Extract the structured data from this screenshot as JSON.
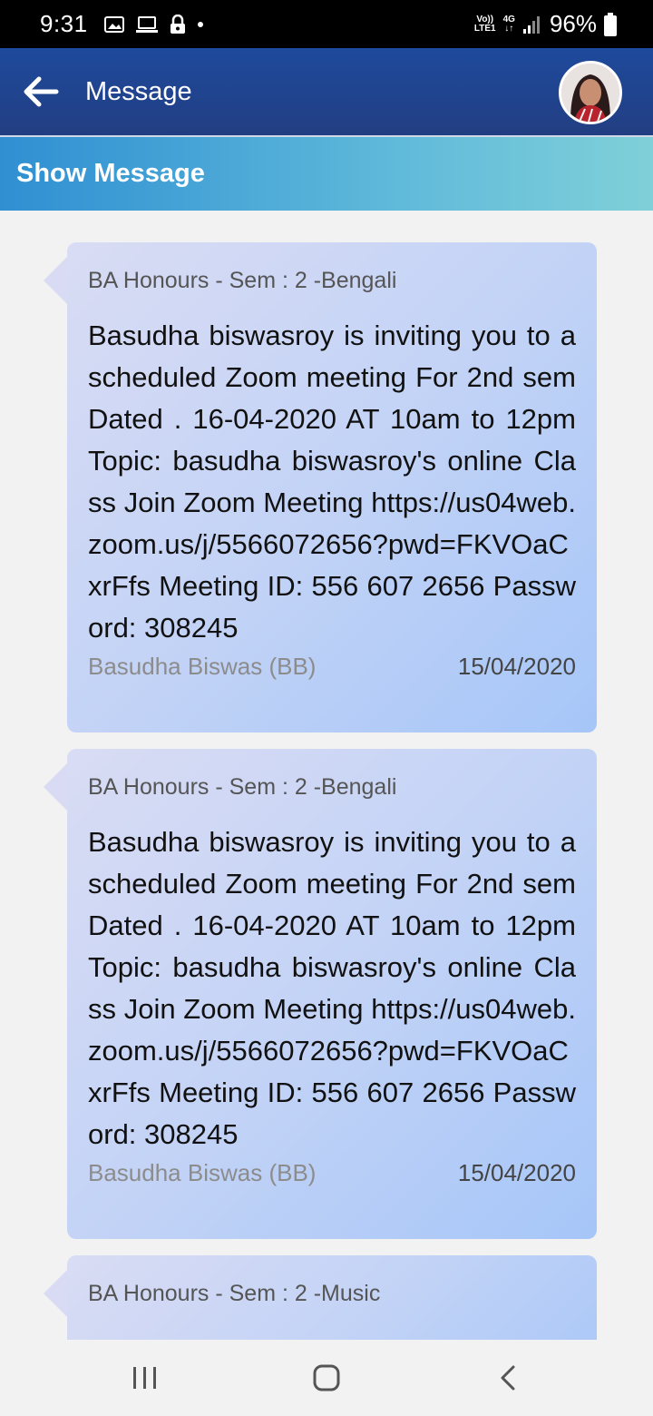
{
  "status_bar": {
    "time": "9:31",
    "network_top": "Vo))",
    "network_bottom": "LTE1",
    "network_type": "4G",
    "battery": "96%"
  },
  "header": {
    "title": "Message"
  },
  "sub_header": {
    "title": "Show Message"
  },
  "messages": [
    {
      "course": "BA Honours - Sem : 2 -Bengali",
      "body": "Basudha biswasroy is inviting you to a scheduled Zoom meeting For 2nd sem Dated . 16-04-2020  AT 10am to 12pm   Topic: basudha biswasroy's online Class Join Zoom Meeting https://us04web.zoom.us/j/5566072656?pwd=FKVOaCxrFfs Meeting ID: 556 607 2656 Password: 308245",
      "sender": "Basudha Biswas (BB)",
      "date": "15/04/2020"
    },
    {
      "course": "BA Honours - Sem : 2 -Bengali",
      "body": "Basudha biswasroy is inviting you to a scheduled Zoom meeting For 2nd sem Dated . 16-04-2020  AT 10am to 12pm   Topic: basudha biswasroy's online Class Join Zoom Meeting https://us04web.zoom.us/j/5566072656?pwd=FKVOaCxrFfs Meeting ID: 556 607 2656 Password: 308245",
      "sender": "Basudha Biswas (BB)",
      "date": "15/04/2020"
    },
    {
      "course": "BA Honours - Sem : 2 -Music"
    }
  ],
  "icons": {
    "back": "arrow-left-icon",
    "nav_recents": "recents-icon",
    "nav_home": "home-icon",
    "nav_back": "chevron-left-icon"
  },
  "colors": {
    "header": "#223e82",
    "sub_header_start": "#2f8fd2",
    "sub_header_end": "#7fd0d8",
    "card": "#c3d3f6"
  }
}
